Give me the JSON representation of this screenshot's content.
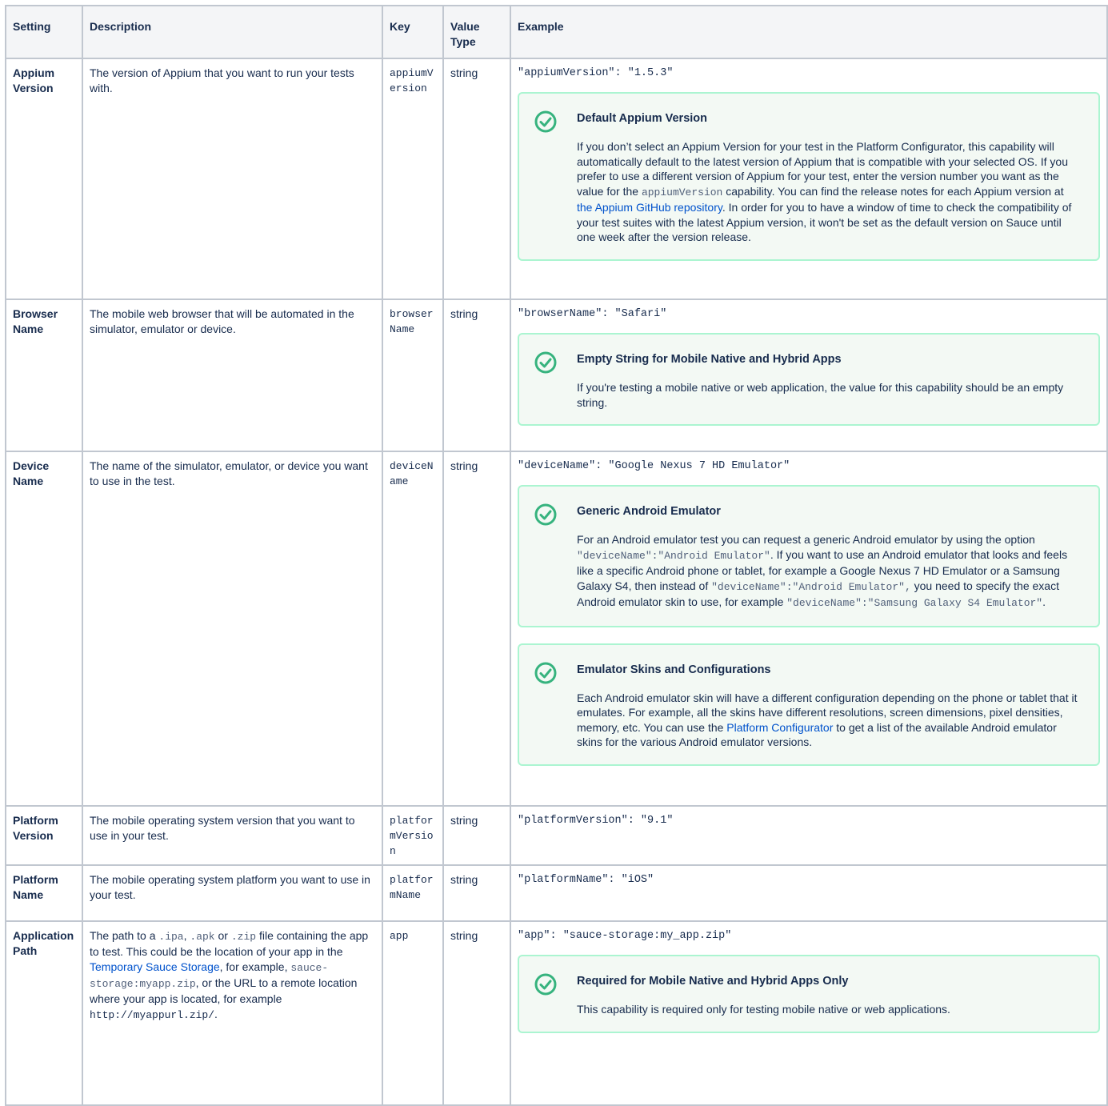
{
  "headers": {
    "setting": "Setting",
    "description": "Description",
    "key": "Key",
    "value_type": "Value Type",
    "example": "Example"
  },
  "rows": [
    {
      "setting": "Appium Version",
      "description": "The version of Appium that you want to run your tests with.",
      "key": "appiumVersion",
      "type": "string",
      "example": "\"appiumVersion\": \"1.5.3\"",
      "panel": {
        "title": "Default Appium Version",
        "text_a": "If you don’t select an Appium Version for your test in the Platform Configurator, this capability will automatically default to the latest version of Appium that is compatible with your selected OS. If you prefer to use a different version of Appium for your test, enter the version number you want as the value for the ",
        "code": "appiumVersion",
        "text_b": " capability. You can find the release notes for each Appium version at ",
        "link": "the Appium GitHub repository",
        "text_c": ". In order for you to have a window of time to check the compatibility of your test suites with the latest Appium version, it won't be set as the default version on Sauce until one week after the version release."
      }
    },
    {
      "setting": "Browser Name",
      "description": "The mobile web browser that will be automated in the simulator, emulator or device.",
      "key": "browserName",
      "type": "string",
      "example": "\"browserName\": \"Safari\"",
      "panel": {
        "title": "Empty String for Mobile Native and Hybrid Apps",
        "text": "If you're testing a mobile native or web application, the value for this capability should be an empty string."
      }
    },
    {
      "setting": "Device Name",
      "description": "The name of the simulator, emulator, or device you want to use in the test.",
      "key": "deviceName",
      "type": "string",
      "example": "\"deviceName\": \"Google Nexus 7 HD Emulator\"",
      "panel1": {
        "title": "Generic Android Emulator",
        "text_a": "For an Android emulator test you can request a generic Android emulator by using the option ",
        "code_a": "\"deviceName\":\"Android Emulator\"",
        "text_b": ". If you want to use an Android emulator that looks and feels like a specific Android phone or tablet, for example a Google Nexus 7 HD Emulator or a Samsung Galaxy S4, then instead of ",
        "code_b": "\"deviceName\":\"Android Emulator\",",
        "text_c": " you need to specify the exact Android emulator skin to use, for example ",
        "code_c": "\"deviceName\":\"Samsung Galaxy S4 Emulator\"",
        "text_d": "."
      },
      "panel2": {
        "title": "Emulator Skins and Configurations",
        "text_a": "Each Android emulator skin will have a different configuration depending on the phone or tablet that it emulates. For example, all the skins have different resolutions, screen dimensions, pixel densities, memory, etc. You can use the ",
        "link": "Platform Configurator",
        "text_b": " to get a list of the available Android emulator skins for the various Android emulator versions."
      }
    },
    {
      "setting": "Platform Version",
      "description": "The mobile operating system version that you want to use in your test.",
      "key": "platformVersion",
      "type": "string",
      "example": "\"platformVersion\": \"9.1\""
    },
    {
      "setting": "Platform Name",
      "description": "The mobile operating system platform you want to use in your test.",
      "key": "platformName",
      "type": "string",
      "example": "\"platformName\": \"iOS\""
    },
    {
      "setting": "Application Path",
      "desc_a": "The path to a ",
      "desc_code1": ".ipa",
      "desc_b": ", ",
      "desc_code2": ".apk",
      "desc_c": " or ",
      "desc_code3": ".zip",
      "desc_d": " file containing the app to test. This could be the location of your app in the ",
      "desc_link": "Temporary Sauce Storage",
      "desc_e": ", for example, ",
      "desc_code4": "sauce-storage:myapp.zip",
      "desc_f": ", or the URL to a remote location where your app is located, for example ",
      "desc_code5": "http://myappurl.zip/",
      "desc_g": ".",
      "key": "app",
      "type": "string",
      "example": "\"app\": \"sauce-storage:my_app.zip\"",
      "panel": {
        "title": "Required for Mobile Native and Hybrid Apps Only",
        "text": "This capability is required only for testing mobile native or web applications."
      }
    }
  ],
  "colors": {
    "panel_border": "#abf5d1",
    "panel_bg": "#f3f9f4",
    "icon": "#36b37e",
    "link": "#0052cc"
  },
  "icons": {
    "panel_icon": "check-circle-icon"
  }
}
